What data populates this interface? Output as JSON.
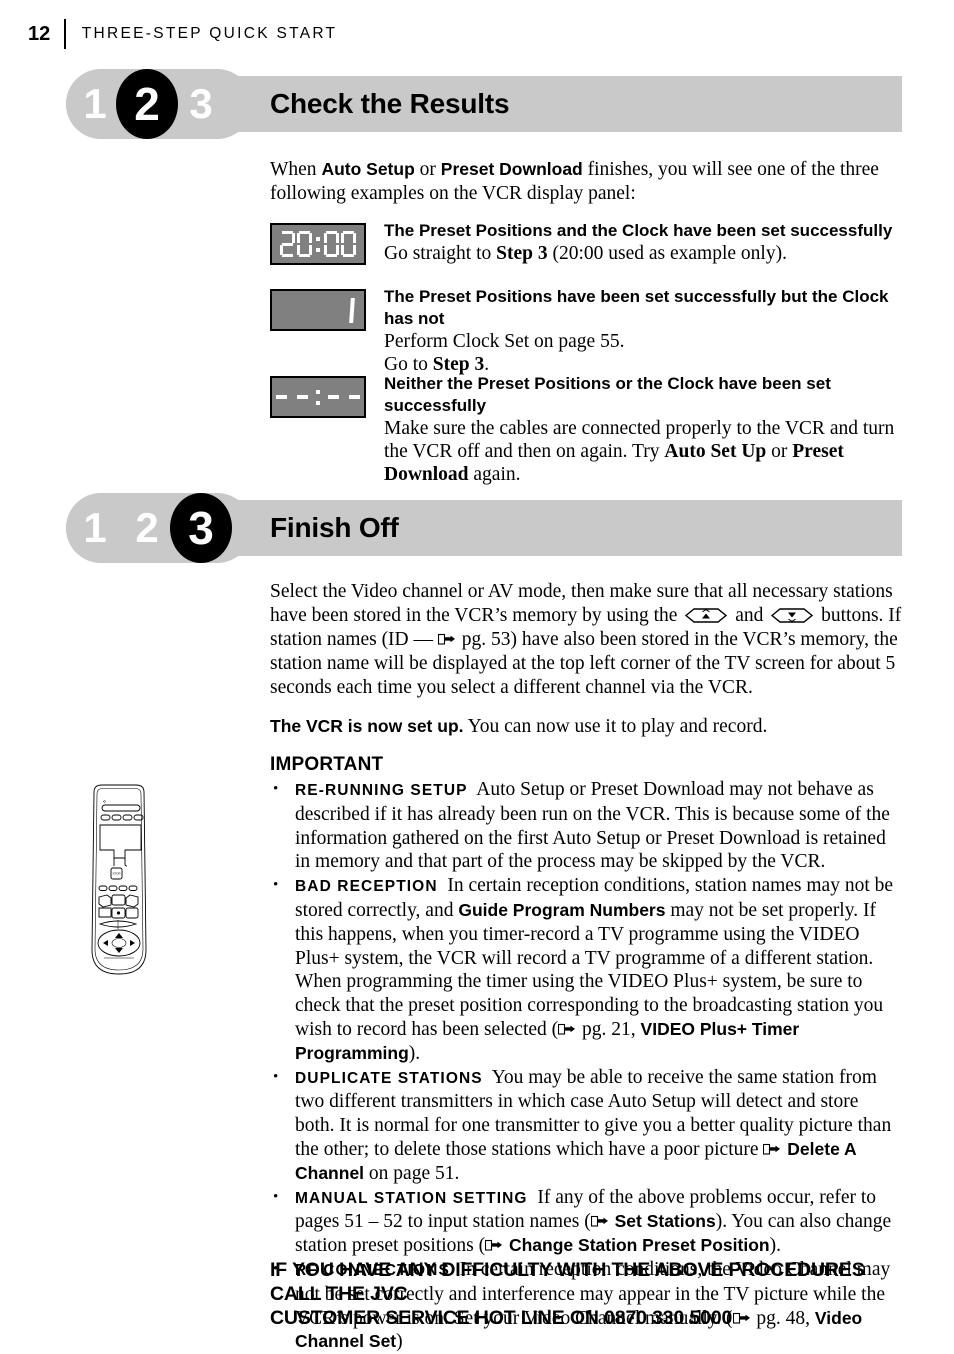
{
  "running_head": {
    "page_number": "12",
    "title": "THREE-STEP QUICK START"
  },
  "sections": [
    {
      "steps": [
        "1",
        "2",
        "3"
      ],
      "active_step": "2",
      "title": "Check the Results",
      "intro_1": "When ",
      "intro_b1": "Auto Setup",
      "intro_2": " or ",
      "intro_b2": "Preset Download",
      "intro_3": " finishes, you will see one of the three following examples on the VCR display panel:",
      "displays": [
        {
          "lcd_value": "20:00",
          "heading": "The Preset Positions and the Clock have been set successfully",
          "text_1": "Go straight to ",
          "text_b": "Step 3",
          "text_2": " (20:00 used as example only)."
        },
        {
          "lcd_value": "1",
          "heading": "The Preset Positions have been set successfully but the Clock has not",
          "text_1": "Perform Clock Set on page 55.",
          "text_2a": "Go to ",
          "text_b": "Step 3",
          "text_2b": "."
        },
        {
          "lcd_value": "--:--",
          "heading": "Neither the Preset Positions or the Clock have been set successfully",
          "text_1": "Make sure the cables are connected properly to the VCR and turn the VCR off and then on again. Try ",
          "text_b1": "Auto Set Up",
          "text_2": " or ",
          "text_b2": "Preset Download",
          "text_3": " again."
        }
      ]
    },
    {
      "steps": [
        "1",
        "2",
        "3"
      ],
      "active_step": "3",
      "title": "Finish Off",
      "para_1": "Select the Video channel or AV mode, then make sure that all necessary stations have been stored in the VCR’s memory by using the ",
      "para_2": " and ",
      "para_3": " buttons. If station names (ID — ",
      "para_4": " pg. 53) have also been stored in the VCR’s memory, the station name will be displayed at the top left corner of the TV screen for about 5 seconds each time you select a different channel via the VCR.",
      "setup_bold": "The VCR is now set up.",
      "setup_rest": " You can now use it to play and record.",
      "important_title": "IMPORTANT",
      "bullets": [
        {
          "term": "RE-RUNNING SETUP",
          "text": "Auto Setup or Preset Download may not behave as described if it has already been run on the VCR. This is because some of the information gathered on the first Auto Setup or Preset Download is retained in memory and that part of the process may be skipped by the VCR."
        },
        {
          "term": "BAD RECEPTION",
          "t1": "In certain reception conditions, station names may not be stored correctly, and ",
          "b1": "Guide Program Numbers",
          "t2": " may not be set properly. If this happens, when you timer-record a TV programme using the VIDEO Plus+ system, the VCR will record a TV programme of a different station. When programming the timer using the VIDEO Plus+ system, be sure to check that the preset position corresponding to the broadcasting station you wish to record has been selected (",
          "t3": " pg. 21, ",
          "b2": "VIDEO Plus+ Timer Programming",
          "t4": ")."
        },
        {
          "term": "DUPLICATE STATIONS",
          "t1": "You may be able to receive the same station from two different transmitters in which case Auto Setup will detect and store both. It is normal for one transmitter to give you a better quality picture than the other; to delete those stations which have a poor picture ",
          "b1": "Delete A Channel",
          "t2": " on page 51."
        },
        {
          "term": "MANUAL STATION SETTING",
          "t1": "If any of the above problems occur, refer to pages 51 – 52 to input station names (",
          "b1": "Set Stations",
          "t2": "). You can also change station preset positions (",
          "b2": "Change Station Preset Position",
          "t3": ")."
        },
        {
          "term": "RF CONNECTIONS",
          "t1": "In certain reception conditions, the Video Channel may not be set correctly and interference may appear in the TV picture while the VCR’s power is on. Set your Video Channel manually. (",
          "t2": " pg. 48, ",
          "b1": "Video Channel Set",
          "t3": ")"
        }
      ],
      "callout_line1": "IF YOU HAVE ANY DIFFICULTY WITH THE ABOVE PROCEDURES CALL THE JVC",
      "callout_line2": "CUSTOMER SERVICE HOT LINE ON 0870 330 5000"
    }
  ],
  "colors": {
    "header_bar": "#c9c9c9",
    "step_inactive": "#c9c9c9",
    "step_active": "#000000",
    "lcd_background": "#808080",
    "lcd_segment": "#ffffff",
    "page_background": "#ffffff",
    "text": "#000000"
  },
  "icons": {
    "channel_up": "channel-up-button-icon",
    "channel_down": "channel-down-button-icon",
    "pointing_hand": "pointing-hand-reference-icon",
    "remote": "remote-control-illustration"
  }
}
